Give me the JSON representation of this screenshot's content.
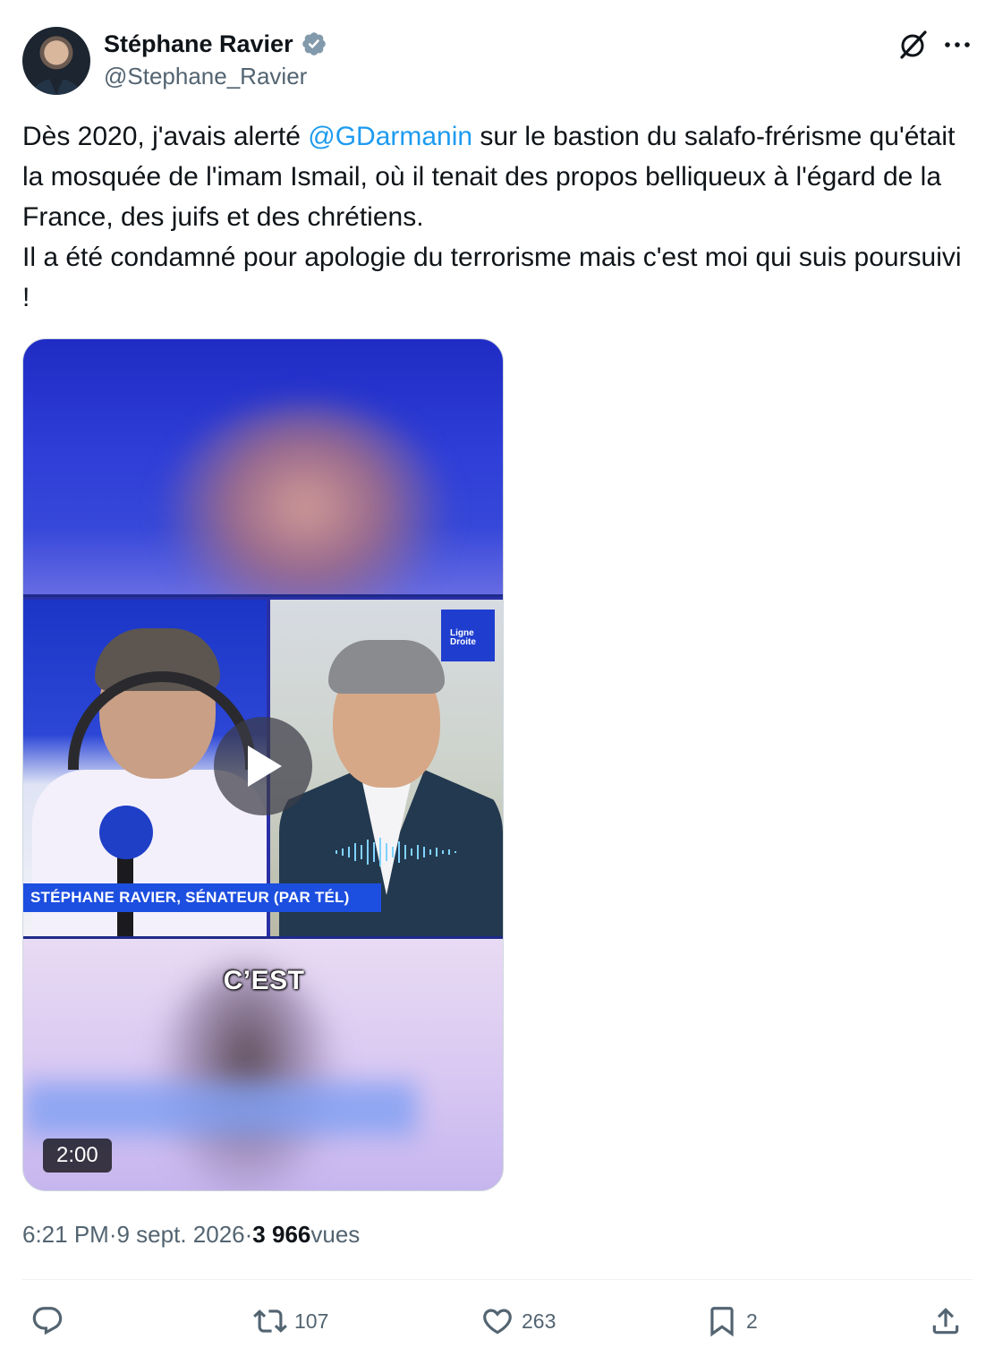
{
  "author": {
    "display_name": "Stéphane Ravier",
    "handle": "@Stephane_Ravier",
    "verified_icon": "verified-badge-icon"
  },
  "header_actions": {
    "grok_icon": "grok-icon",
    "more_icon": "more-icon"
  },
  "tweet": {
    "text_part1": "Dès 2020, j'avais alerté ",
    "mention": "@GDarmanin",
    "text_part2": " sur le bastion du salafo-frérisme qu'était la mosquée de l'imam Ismail, où il tenait des propos belliqueux à l'égard de la France, des juifs et des chrétiens.",
    "text_line2": "Il a été condamné pour apologie du terrorisme mais c'est moi qui suis poursuivi !"
  },
  "media": {
    "caption_bar": "STÉPHANE RAVIER, SÉNATEUR (PAR TÉL)",
    "subtitle": "C’EST",
    "logo_text_1": "Ligne",
    "logo_text_2": "Droite",
    "duration": "2:00"
  },
  "meta": {
    "time": "6:21 PM",
    "separator": " · ",
    "date": "9 sept. 2026",
    "views_count": "3 966",
    "views_label": " vues"
  },
  "actions": {
    "reply_count": "",
    "retweet_count": "107",
    "like_count": "263",
    "bookmark_count": "2"
  },
  "colors": {
    "accent": "#1d9bf0",
    "secondary_text": "#536471",
    "primary_text": "#0f1419"
  }
}
